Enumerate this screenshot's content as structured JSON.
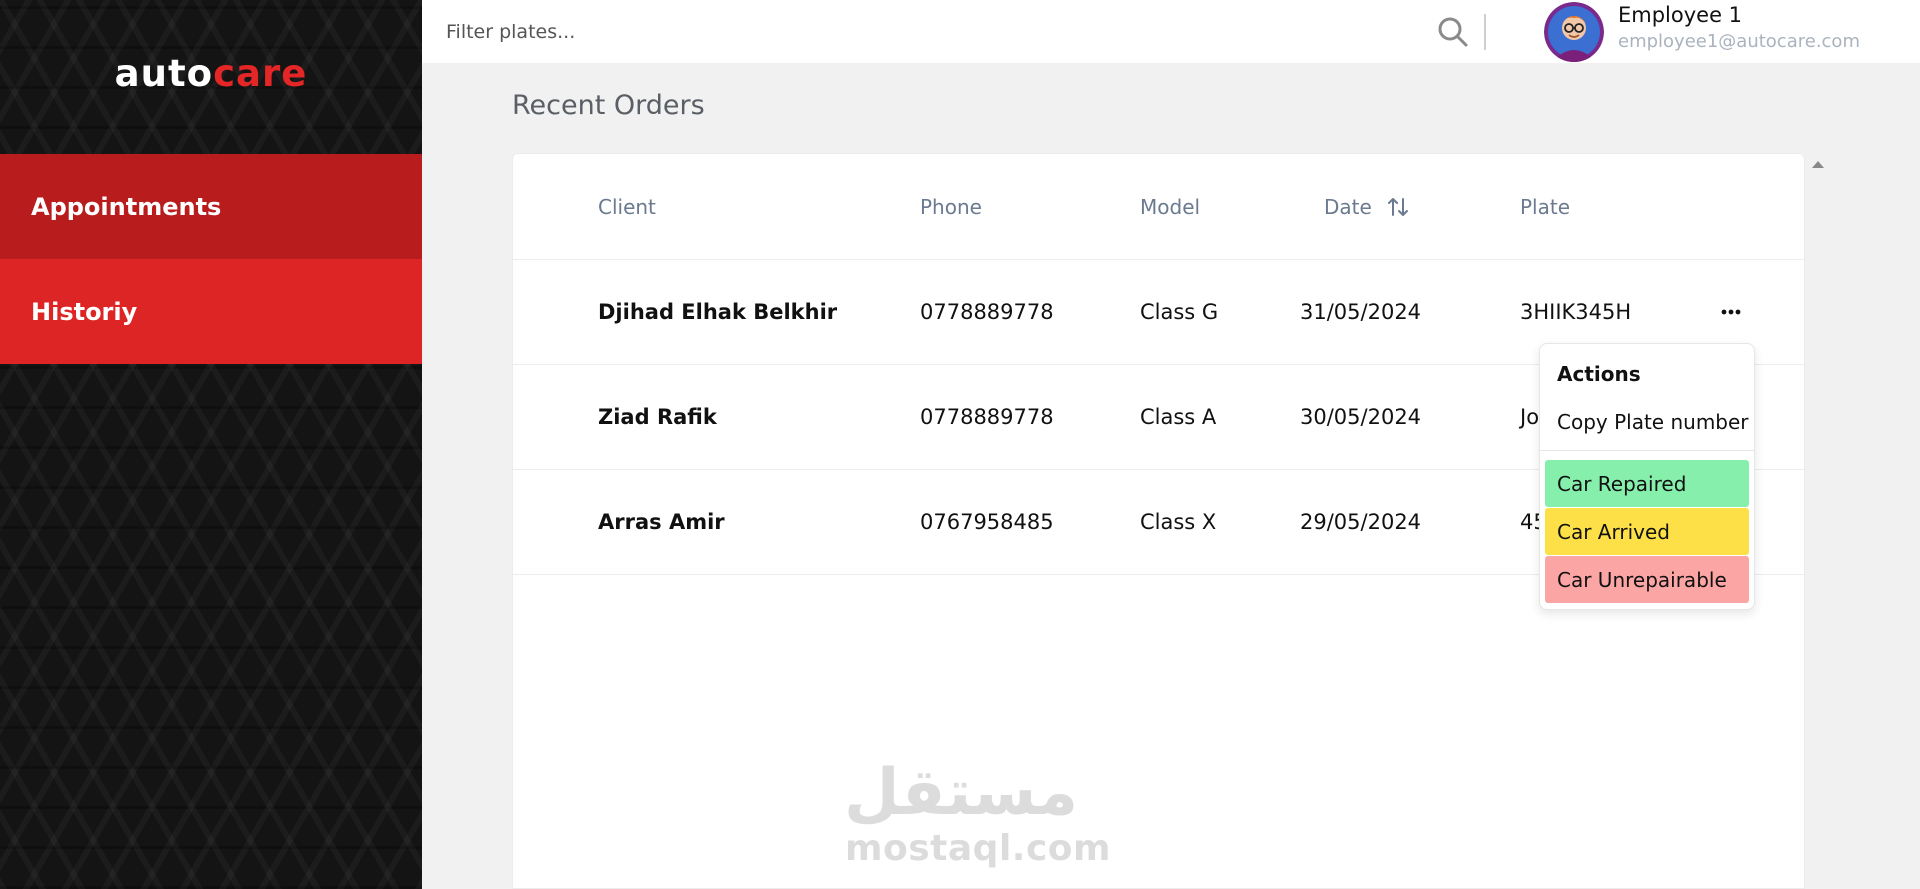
{
  "sidebar": {
    "logo": {
      "part1": "auto",
      "part2": "care"
    },
    "items": [
      {
        "label": "Appointments"
      },
      {
        "label": "Historiy"
      }
    ]
  },
  "topbar": {
    "filter_placeholder": "Filter plates...",
    "user": {
      "name": "Employee 1",
      "email": "employee1@autocare.com"
    }
  },
  "main": {
    "title": "Recent Orders",
    "table": {
      "columns": {
        "client": "Client",
        "phone": "Phone",
        "model": "Model",
        "date": "Date",
        "plate": "Plate"
      },
      "rows": [
        {
          "client": "Djihad Elhak Belkhir",
          "phone": "0778889778",
          "model": "Class G",
          "date": "31/05/2024",
          "plate": "3HIIK345H"
        },
        {
          "client": "Ziad Rafik",
          "phone": "0778889778",
          "model": "Class A",
          "date": "30/05/2024",
          "plate": "Jo"
        },
        {
          "client": "Arras Amir",
          "phone": "0767958485",
          "model": "Class X",
          "date": "29/05/2024",
          "plate": "45"
        }
      ]
    },
    "actions_menu": {
      "label": "Actions",
      "copy": "Copy Plate number",
      "statuses": [
        "Car Repaired",
        "Car Arrived",
        "Car Unrepairable"
      ]
    }
  },
  "watermark": {
    "arabic": "مستقل",
    "latin": "mostaql.com"
  },
  "colors": {
    "nav_active": "#b81c1c",
    "nav_default": "#de2525",
    "repaired": "#86efac",
    "arrived": "#fde047",
    "unrepairable": "#fca5a5"
  },
  "icons": [
    "search-icon",
    "sort-icon",
    "more-icon",
    "chevron-up-icon"
  ]
}
